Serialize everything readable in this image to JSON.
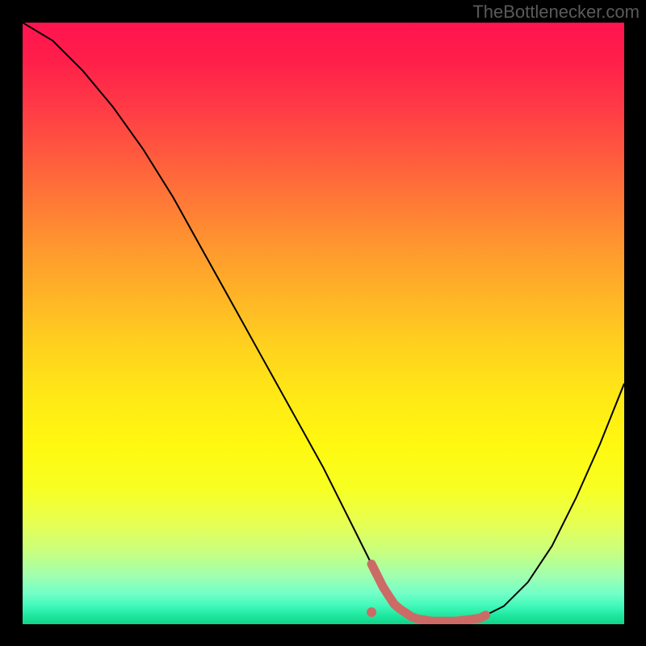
{
  "watermark": "TheBottlenecker.com",
  "chart_data": {
    "type": "line",
    "title": "",
    "xlabel": "",
    "ylabel": "",
    "xlim": [
      0,
      100
    ],
    "ylim": [
      0,
      100
    ],
    "series": [
      {
        "name": "bottleneck-curve",
        "x": [
          0,
          5,
          10,
          15,
          20,
          25,
          30,
          35,
          40,
          45,
          50,
          55,
          58,
          60,
          62,
          65,
          68,
          72,
          76,
          80,
          84,
          88,
          92,
          96,
          100
        ],
        "y": [
          100,
          97,
          92,
          86,
          79,
          71,
          62,
          53,
          44,
          35,
          26,
          16,
          10,
          6,
          3,
          1,
          0.5,
          0.5,
          1,
          3,
          7,
          13,
          21,
          30,
          40
        ]
      }
    ],
    "highlight_range": {
      "x_start": 58,
      "x_end": 77,
      "y": 0.6
    },
    "highlight_point": {
      "x": 58,
      "y": 2
    },
    "background_gradient": {
      "top": "#ff1450",
      "mid": "#ffe816",
      "bottom": "#0fd488"
    }
  }
}
